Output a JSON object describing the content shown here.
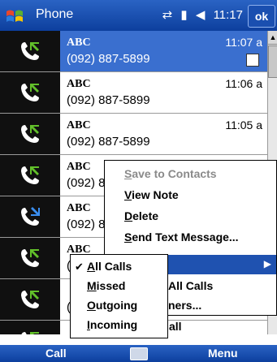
{
  "titlebar": {
    "app_title": "Phone",
    "time": "11:17",
    "ok_label": "ok",
    "icons": [
      "start-flag-icon",
      "connectivity-icon",
      "signal-icon",
      "volume-icon"
    ]
  },
  "calls": [
    {
      "name": "ABC",
      "number": "(092) 887-5899",
      "time": "11:07 a",
      "direction": "incoming",
      "selected": true,
      "has_note": true
    },
    {
      "name": "ABC",
      "number": "(092) 887-5899",
      "time": "11:06 a",
      "direction": "incoming",
      "selected": false
    },
    {
      "name": "ABC",
      "number": "(092) 887-5899",
      "time": "11:05 a",
      "direction": "incoming",
      "selected": false
    },
    {
      "name": "ABC",
      "number": "(092) 8",
      "time": "",
      "direction": "incoming",
      "selected": false
    },
    {
      "name": "ABC",
      "number": "(092) 8",
      "time": "",
      "direction": "outgoing",
      "selected": false
    },
    {
      "name": "ABC",
      "number": "(",
      "time": "",
      "direction": "incoming",
      "selected": false
    },
    {
      "name": "",
      "number": "(",
      "time": "",
      "direction": "incoming",
      "selected": false
    },
    {
      "name": "",
      "number": "",
      "time": "",
      "direction": "incoming",
      "selected": false
    }
  ],
  "context_menu": {
    "items": [
      {
        "label": "Save to Contacts",
        "enabled": false
      },
      {
        "label": "View Note",
        "enabled": true
      },
      {
        "label": "Delete",
        "enabled": true
      },
      {
        "label": "Send Text Message...",
        "enabled": true
      }
    ],
    "partial_items": [
      "All Calls",
      "ners...",
      "all"
    ]
  },
  "filter_submenu": {
    "items": [
      {
        "label": "All Calls",
        "checked": true
      },
      {
        "label": "Missed",
        "checked": false
      },
      {
        "label": "Outgoing",
        "checked": false
      },
      {
        "label": "Incoming",
        "checked": false
      }
    ]
  },
  "softkeys": {
    "left": "Call",
    "right": "Menu"
  },
  "colors": {
    "titlebar": "#1a4fb0",
    "selection": "#3a6fcf",
    "menu_highlight": "#1f52b0"
  }
}
